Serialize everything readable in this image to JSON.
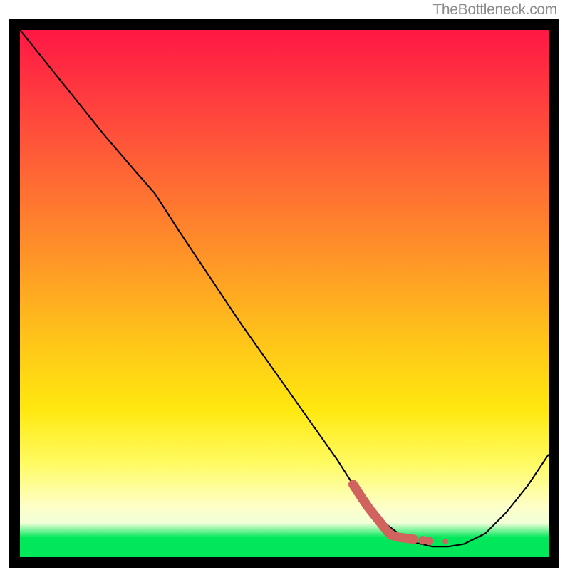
{
  "watermark": "TheBottleneck.com",
  "chart_data": {
    "type": "line",
    "title": "",
    "xlabel": "",
    "ylabel": "",
    "xlim": [
      0,
      100
    ],
    "ylim": [
      0,
      100
    ],
    "gradient_bands": [
      {
        "color": "#ff1745",
        "stop": 0
      },
      {
        "color": "#ff4b3c",
        "stop": 18
      },
      {
        "color": "#ff8b2a",
        "stop": 40
      },
      {
        "color": "#ffc21a",
        "stop": 58
      },
      {
        "color": "#ffe80f",
        "stop": 72
      },
      {
        "color": "#fffb60",
        "stop": 82
      },
      {
        "color": "#fdffc8",
        "stop": 90.5
      },
      {
        "color": "#f2ffd8",
        "stop": 93.5
      },
      {
        "color": "#00e85a",
        "stop": 96.3
      },
      {
        "color": "#00e85a",
        "stop": 100
      }
    ],
    "series": [
      {
        "name": "bottleneck-curve",
        "x": [
          0,
          4,
          10,
          16,
          22,
          25.5,
          30,
          36,
          42,
          48,
          54,
          60,
          63.5,
          66,
          69,
          72,
          75,
          78,
          81,
          84,
          88,
          92,
          96,
          100
        ],
        "y": [
          100,
          95,
          87.5,
          80,
          73,
          69,
          62,
          53,
          44,
          35.5,
          27,
          18.5,
          13,
          9.5,
          6.5,
          4.2,
          2.7,
          2.0,
          2.0,
          2.5,
          4.5,
          8.5,
          13.5,
          19.5
        ]
      }
    ],
    "highlight_segment": {
      "color": "#d1635f",
      "points": [
        {
          "x": 63.0,
          "y": 13.8
        },
        {
          "x": 64.5,
          "y": 11.5
        },
        {
          "x": 66.0,
          "y": 9.3
        },
        {
          "x": 67.5,
          "y": 7.4
        },
        {
          "x": 68.7,
          "y": 5.9
        },
        {
          "x": 69.6,
          "y": 4.8
        },
        {
          "x": 70.2,
          "y": 4.2
        },
        {
          "x": 71.5,
          "y": 3.8
        },
        {
          "x": 73.0,
          "y": 3.6
        },
        {
          "x": 74.5,
          "y": 3.4
        }
      ],
      "extra_dots": [
        {
          "x": 76.2,
          "y": 3.2
        },
        {
          "x": 77.4,
          "y": 3.1
        },
        {
          "x": 80.5,
          "y": 3.0
        }
      ]
    }
  }
}
